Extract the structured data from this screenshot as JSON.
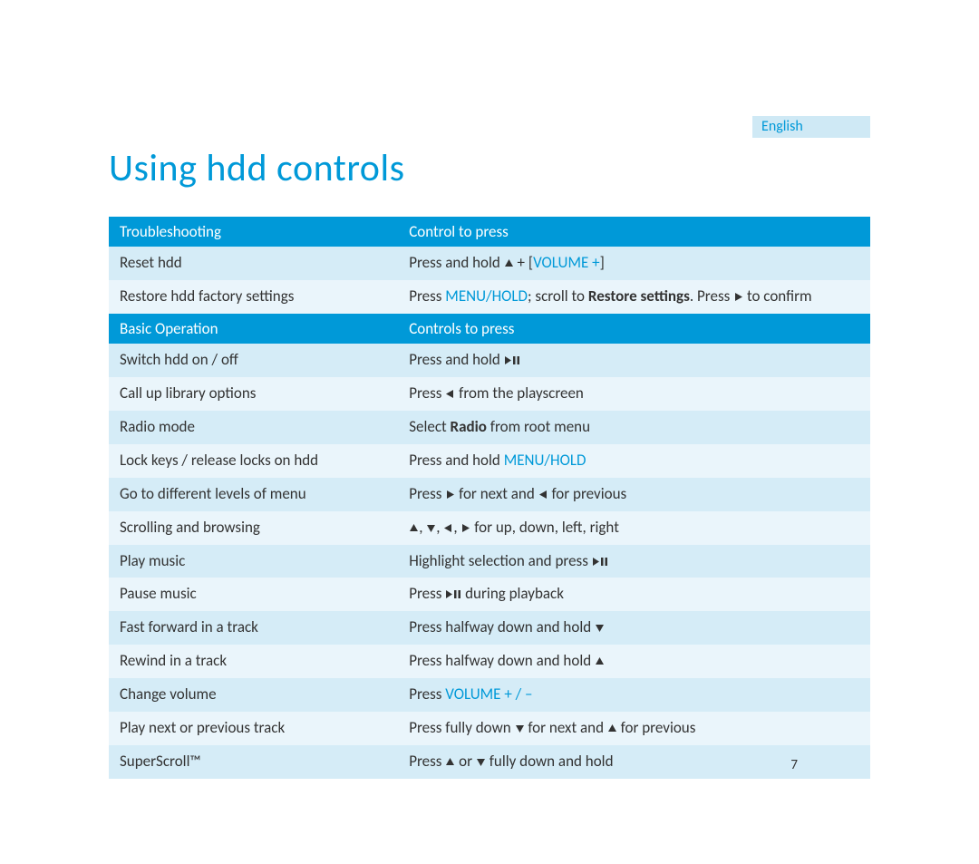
{
  "language_tab": "English",
  "title": "Using hdd controls",
  "page_number": "7",
  "sections": [
    {
      "header_left": "Troubleshooting",
      "header_right": "Control to press",
      "rows": [
        {
          "action": "Reset hdd",
          "control": "Press and hold {up} + [{VOLUME+}]"
        },
        {
          "action": "Restore hdd factory settings",
          "control": "Press {MENU/HOLD}; scroll to {bold:Restore settings}. Press {right} to confirm"
        }
      ]
    },
    {
      "header_left": "Basic Operation",
      "header_right": "Controls to press",
      "rows": [
        {
          "action": "Switch hdd on / off",
          "control": "Press and hold {playpause}"
        },
        {
          "action": "Call up library options",
          "control": "Press {left} from the playscreen"
        },
        {
          "action": "Radio mode",
          "control": "Select {bold:Radio} from root menu"
        },
        {
          "action": "Lock keys / release locks on hdd",
          "control": "Press and hold {MENU/HOLD}"
        },
        {
          "action": "Go to different levels of menu",
          "control": "Press {right} for next and {left} for previous"
        },
        {
          "action": "Scrolling and browsing",
          "control": "{up}, {down}, {left}, {right} for up, down, left, right"
        },
        {
          "action": "Play music",
          "control": "Highlight selection and press {playpause}"
        },
        {
          "action": "Pause music",
          "control": "Press {playpause} during playback"
        },
        {
          "action": "Fast forward in a track",
          "control": "Press halfway down and hold {down}"
        },
        {
          "action": "Rewind in a track",
          "control": "Press halfway down and hold {up}"
        },
        {
          "action": "Change volume",
          "control": "Press {VOLUME+/-}"
        },
        {
          "action": "Play next or previous track",
          "control": "Press fully down {down} for next and {up} for previous"
        },
        {
          "action": "SuperScroll™",
          "control": "Press {up} or {down} fully down and hold"
        }
      ]
    }
  ]
}
